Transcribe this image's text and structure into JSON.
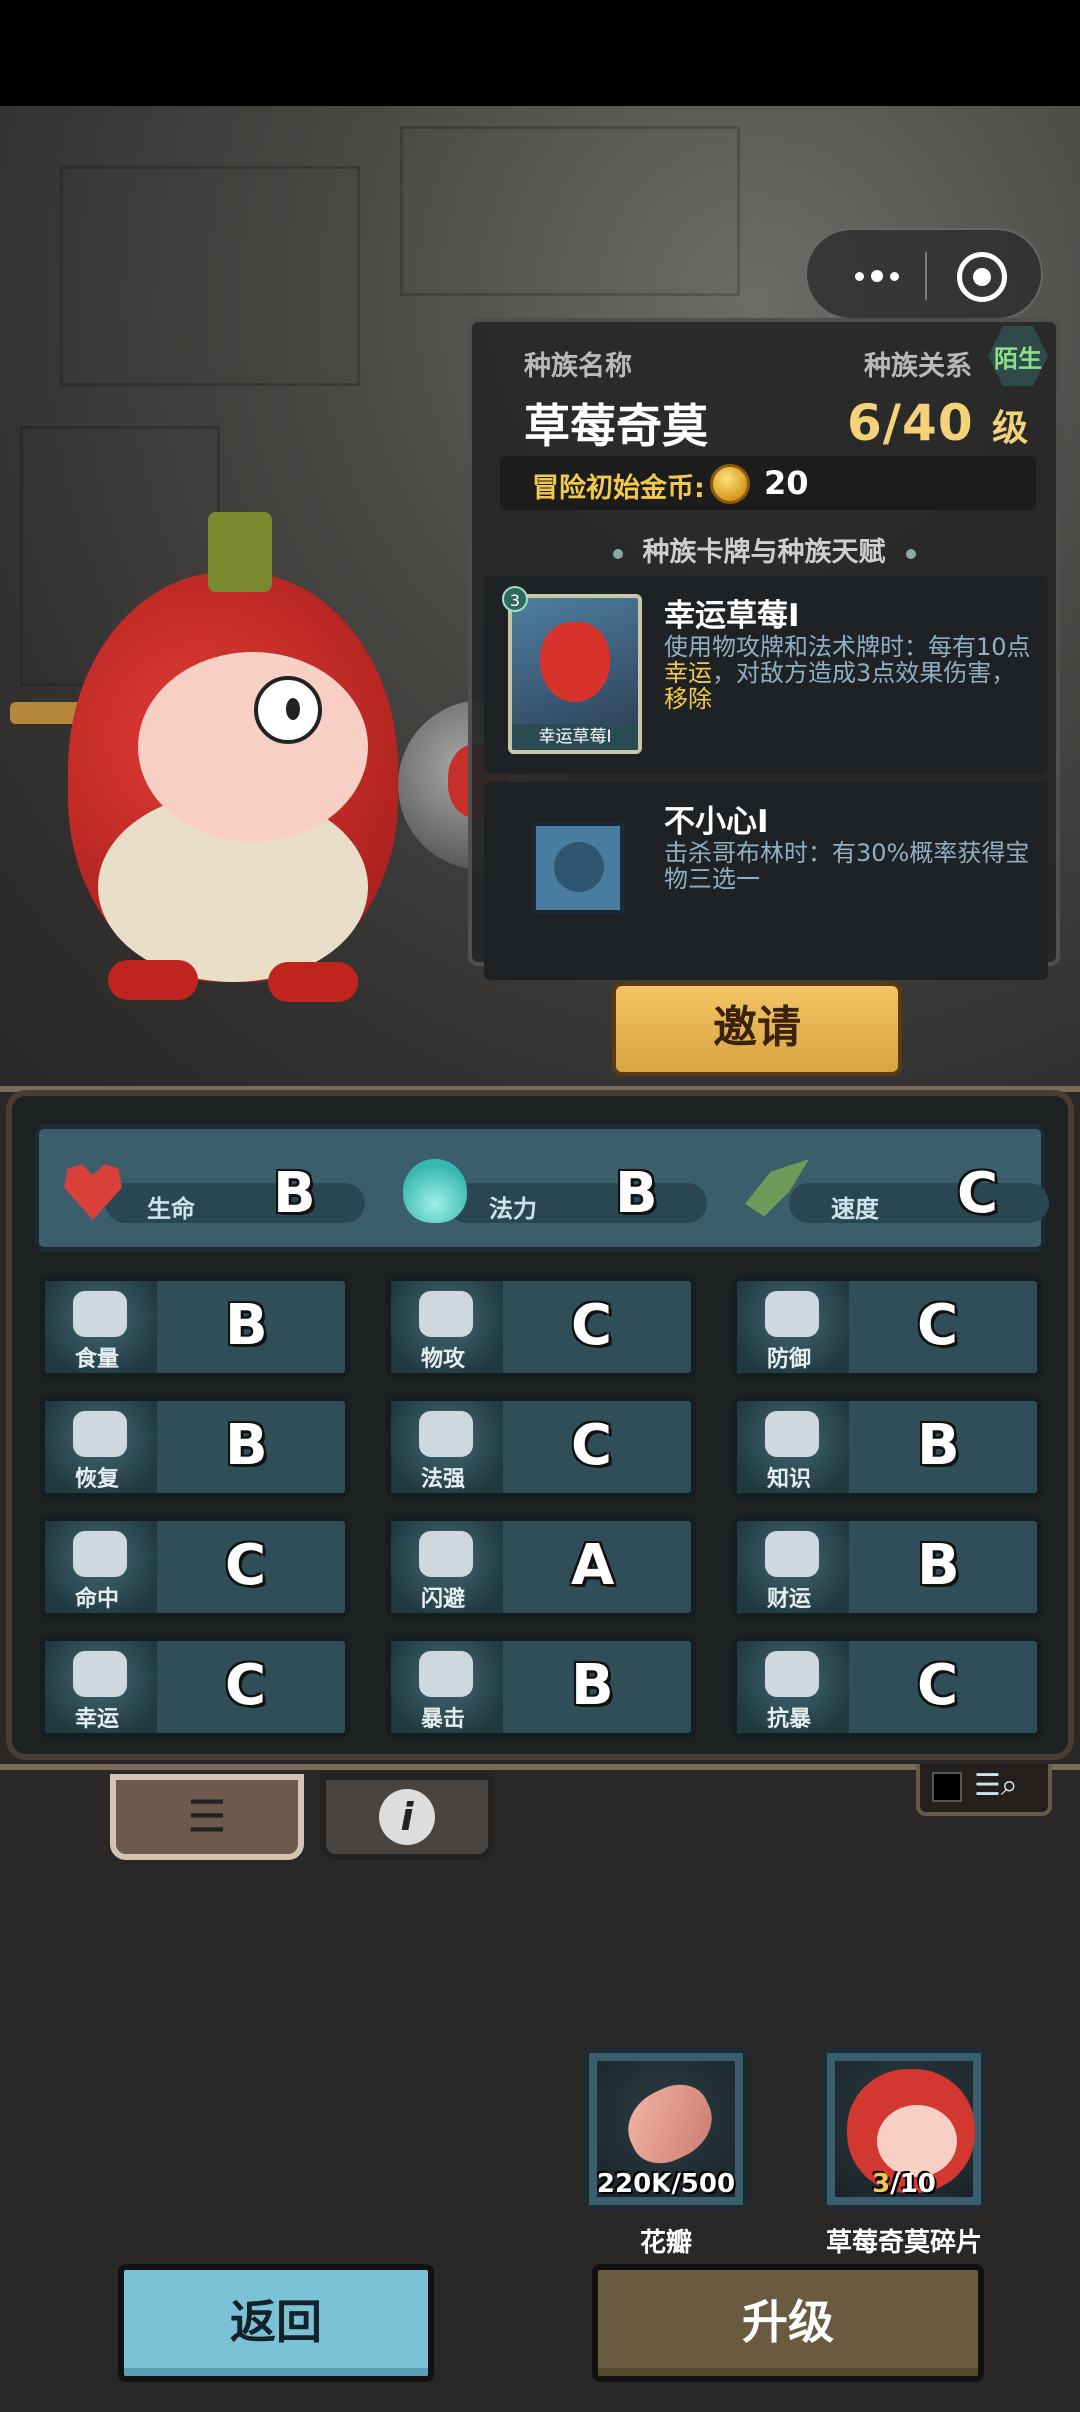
{
  "menu": {
    "more_icon": "more-dots-icon",
    "close_icon": "target-circle-icon"
  },
  "race_panel": {
    "race_name_label": "种族名称",
    "race_name": "草莓奇莫",
    "relation_label": "种族关系",
    "relation_value": "陌生",
    "level_value": "6/40",
    "level_unit": "级",
    "gold_label": "冒险初始金币:",
    "gold_value": "20",
    "section_title": "种族卡牌与种族天赋",
    "card": {
      "badge": "3",
      "name": "幸运草莓I",
      "image_caption": "幸运草莓I",
      "desc_a": "使用物攻牌和法术牌时：每有10点",
      "desc_hl1": "幸运",
      "desc_b": "，对敌方造成3点效果伤害，",
      "desc_hl2": "移除"
    },
    "talent": {
      "name": "不小心I",
      "desc": "击杀哥布林时：有30%概率获得宝物三选一"
    }
  },
  "invite_button": "邀请",
  "main_stats": [
    {
      "name": "生命",
      "grade": "B",
      "icon": "heart-icon"
    },
    {
      "name": "法力",
      "grade": "B",
      "icon": "mana-flame-icon"
    },
    {
      "name": "速度",
      "grade": "C",
      "icon": "wing-icon"
    }
  ],
  "stats": [
    {
      "name": "食量",
      "grade": "B",
      "icon": "stomach-icon"
    },
    {
      "name": "物攻",
      "grade": "C",
      "icon": "sword-icon"
    },
    {
      "name": "防御",
      "grade": "C",
      "icon": "armor-icon"
    },
    {
      "name": "恢复",
      "grade": "B",
      "icon": "heart-plus-icon"
    },
    {
      "name": "法强",
      "grade": "C",
      "icon": "staff-icon"
    },
    {
      "name": "知识",
      "grade": "B",
      "icon": "book-icon"
    },
    {
      "name": "命中",
      "grade": "C",
      "icon": "target-icon"
    },
    {
      "name": "闪避",
      "grade": "A",
      "icon": "dodge-arrows-icon"
    },
    {
      "name": "财运",
      "grade": "B",
      "icon": "coin-icon"
    },
    {
      "name": "幸运",
      "grade": "C",
      "icon": "clover-icon"
    },
    {
      "name": "暴击",
      "grade": "B",
      "icon": "crit-sword-icon"
    },
    {
      "name": "抗暴",
      "grade": "C",
      "icon": "shield-wing-icon"
    }
  ],
  "tabs": [
    {
      "icon": "list-icon"
    },
    {
      "icon": "info-icon"
    }
  ],
  "resources": [
    {
      "label": "花瓣",
      "count_main": "220K",
      "count_need": "/500",
      "icon": "petal-icon"
    },
    {
      "label": "草莓奇莫碎片",
      "count_main": "3",
      "count_need": "/10",
      "icon": "strawberry-fragment-icon"
    }
  ],
  "buttons": {
    "back": "返回",
    "upgrade": "升级"
  }
}
